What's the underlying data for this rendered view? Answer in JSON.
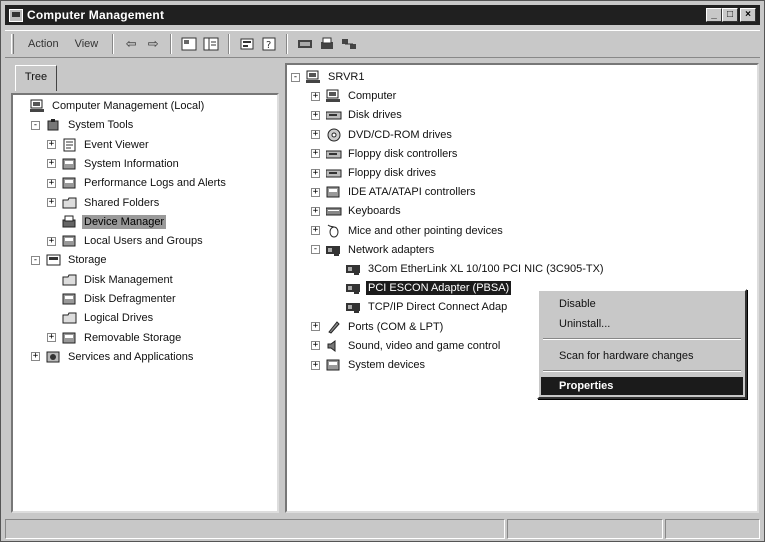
{
  "window": {
    "title": "Computer Management"
  },
  "menu": {
    "action": "Action",
    "view": "View"
  },
  "tabs": {
    "tree": "Tree"
  },
  "left_tree": [
    {
      "label": "Computer Management (Local)",
      "level": 0,
      "exp": "none",
      "icon": "computer-icon"
    },
    {
      "label": "System Tools",
      "level": 1,
      "exp": "-",
      "icon": "tools-icon"
    },
    {
      "label": "Event Viewer",
      "level": 2,
      "exp": "+",
      "icon": "event-viewer-icon"
    },
    {
      "label": "System Information",
      "level": 2,
      "exp": "+",
      "icon": "system-info-icon"
    },
    {
      "label": "Performance Logs and Alerts",
      "level": 2,
      "exp": "+",
      "icon": "performance-icon"
    },
    {
      "label": "Shared Folders",
      "level": 2,
      "exp": "+",
      "icon": "shared-folder-icon"
    },
    {
      "label": "Device Manager",
      "level": 2,
      "exp": "none",
      "icon": "device-manager-icon",
      "selected": true
    },
    {
      "label": "Local Users and Groups",
      "level": 2,
      "exp": "+",
      "icon": "users-icon"
    },
    {
      "label": "Storage",
      "level": 1,
      "exp": "-",
      "icon": "storage-icon"
    },
    {
      "label": "Disk Management",
      "level": 2,
      "exp": "none",
      "icon": "disk-management-icon"
    },
    {
      "label": "Disk Defragmenter",
      "level": 2,
      "exp": "none",
      "icon": "defrag-icon"
    },
    {
      "label": "Logical Drives",
      "level": 2,
      "exp": "none",
      "icon": "logical-drive-icon"
    },
    {
      "label": "Removable Storage",
      "level": 2,
      "exp": "+",
      "icon": "removable-storage-icon"
    },
    {
      "label": "Services and Applications",
      "level": 1,
      "exp": "+",
      "icon": "services-icon"
    }
  ],
  "right_tree": [
    {
      "label": "SRVR1",
      "level": 0,
      "exp": "-",
      "icon": "computer-icon"
    },
    {
      "label": "Computer",
      "level": 1,
      "exp": "+",
      "icon": "computer-icon"
    },
    {
      "label": "Disk drives",
      "level": 1,
      "exp": "+",
      "icon": "disk-drive-icon"
    },
    {
      "label": "DVD/CD-ROM drives",
      "level": 1,
      "exp": "+",
      "icon": "cdrom-icon"
    },
    {
      "label": "Floppy disk controllers",
      "level": 1,
      "exp": "+",
      "icon": "floppy-controller-icon"
    },
    {
      "label": "Floppy disk drives",
      "level": 1,
      "exp": "+",
      "icon": "floppy-drive-icon"
    },
    {
      "label": "IDE ATA/ATAPI controllers",
      "level": 1,
      "exp": "+",
      "icon": "ide-controller-icon"
    },
    {
      "label": "Keyboards",
      "level": 1,
      "exp": "+",
      "icon": "keyboard-icon"
    },
    {
      "label": "Mice and other pointing devices",
      "level": 1,
      "exp": "+",
      "icon": "mouse-icon"
    },
    {
      "label": "Network adapters",
      "level": 1,
      "exp": "-",
      "icon": "network-adapter-icon"
    },
    {
      "label": "3Com EtherLink XL 10/100 PCI NIC (3C905-TX)",
      "level": 2,
      "exp": "none",
      "icon": "network-card-icon"
    },
    {
      "label": "PCI ESCON Adapter (PBSA)",
      "level": 2,
      "exp": "none",
      "icon": "network-card-icon",
      "selected": true
    },
    {
      "label": "TCP/IP Direct Connect Adap",
      "level": 2,
      "exp": "none",
      "icon": "network-card-icon"
    },
    {
      "label": "Ports (COM & LPT)",
      "level": 1,
      "exp": "+",
      "icon": "ports-icon"
    },
    {
      "label": "Sound, video and game control",
      "level": 1,
      "exp": "+",
      "icon": "sound-icon"
    },
    {
      "label": "System devices",
      "level": 1,
      "exp": "+",
      "icon": "system-devices-icon"
    }
  ],
  "context_menu": {
    "disable": "Disable",
    "uninstall": "Uninstall...",
    "scan": "Scan for hardware changes",
    "properties": "Properties"
  },
  "colors": {
    "titlebar": "#202020",
    "selection": "#1b1b1b",
    "chrome": "#c8c8c8"
  }
}
